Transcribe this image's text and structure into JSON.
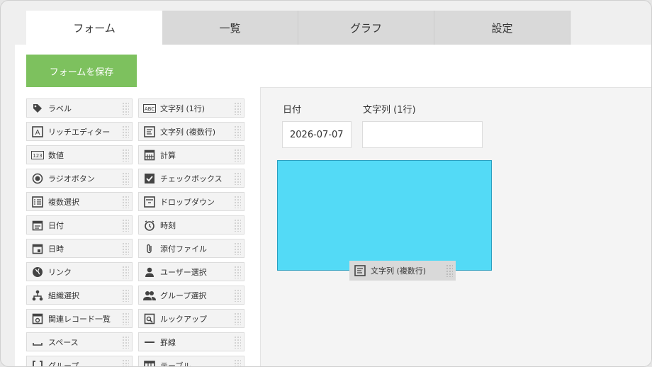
{
  "tabs": [
    {
      "label": "フォーム",
      "active": true
    },
    {
      "label": "一覧",
      "active": false
    },
    {
      "label": "グラフ",
      "active": false
    },
    {
      "label": "設定",
      "active": false
    }
  ],
  "toolbar": {
    "save_label": "フォームを保存",
    "save_color": "#7dc15e"
  },
  "palette": {
    "left": [
      {
        "label": "ラベル",
        "icon": "tag-icon"
      },
      {
        "label": "リッチエディター",
        "icon": "rich-editor-icon"
      },
      {
        "label": "数値",
        "icon": "number-icon"
      },
      {
        "label": "ラジオボタン",
        "icon": "radio-button-icon"
      },
      {
        "label": "複数選択",
        "icon": "multi-select-icon"
      },
      {
        "label": "日付",
        "icon": "calendar-icon"
      },
      {
        "label": "日時",
        "icon": "datetime-icon"
      },
      {
        "label": "リンク",
        "icon": "globe-icon"
      },
      {
        "label": "組織選択",
        "icon": "org-tree-icon"
      },
      {
        "label": "関連レコード一覧",
        "icon": "related-records-icon"
      },
      {
        "label": "スペース",
        "icon": "space-icon"
      },
      {
        "label": "グループ",
        "icon": "group-bracket-icon"
      }
    ],
    "right": [
      {
        "label": "文字列 (1行)",
        "icon": "abc-icon"
      },
      {
        "label": "文字列 (複数行)",
        "icon": "multiline-text-icon"
      },
      {
        "label": "計算",
        "icon": "calculator-icon"
      },
      {
        "label": "チェックボックス",
        "icon": "checkbox-icon"
      },
      {
        "label": "ドロップダウン",
        "icon": "dropdown-icon"
      },
      {
        "label": "時刻",
        "icon": "clock-icon"
      },
      {
        "label": "添付ファイル",
        "icon": "paperclip-icon"
      },
      {
        "label": "ユーザー選択",
        "icon": "user-icon"
      },
      {
        "label": "グループ選択",
        "icon": "users-icon"
      },
      {
        "label": "ルックアップ",
        "icon": "lookup-icon"
      },
      {
        "label": "罫線",
        "icon": "horizontal-rule-icon"
      },
      {
        "label": "テーブル",
        "icon": "table-icon"
      }
    ]
  },
  "form": {
    "fields": [
      {
        "label": "日付",
        "value": "2026-07-07"
      },
      {
        "label": "文字列 (1行)",
        "value": ""
      }
    ],
    "drop_zone_color": "#53daf6",
    "dragging_item": {
      "label": "文字列 (複数行)",
      "icon": "multiline-text-icon"
    }
  }
}
